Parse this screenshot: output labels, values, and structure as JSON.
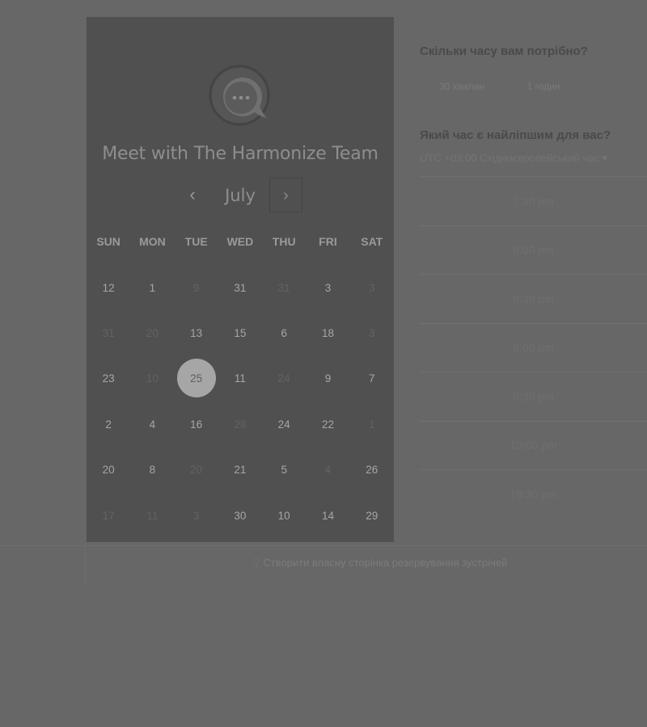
{
  "calendar": {
    "title": "Meet with The Harmonize Team",
    "month": "July",
    "prev_icon": "chevron-left-icon",
    "next_icon": "chevron-right-icon",
    "prev_glyph": "‹",
    "next_glyph": "›",
    "weekdays": [
      "SUN",
      "MON",
      "TUE",
      "WED",
      "THU",
      "FRI",
      "SAT"
    ],
    "weeks": [
      [
        {
          "d": "12",
          "muted": false
        },
        {
          "d": "1",
          "muted": false
        },
        {
          "d": "9",
          "muted": true
        },
        {
          "d": "31",
          "muted": false
        },
        {
          "d": "31",
          "muted": true
        },
        {
          "d": "3",
          "muted": false
        },
        {
          "d": "3",
          "muted": true
        }
      ],
      [
        {
          "d": "31",
          "muted": true
        },
        {
          "d": "20",
          "muted": true
        },
        {
          "d": "13",
          "muted": false
        },
        {
          "d": "15",
          "muted": false
        },
        {
          "d": "6",
          "muted": false
        },
        {
          "d": "18",
          "muted": false
        },
        {
          "d": "3",
          "muted": true
        }
      ],
      [
        {
          "d": "23",
          "muted": false
        },
        {
          "d": "10",
          "muted": true
        },
        {
          "d": "25",
          "muted": false,
          "selected": true
        },
        {
          "d": "11",
          "muted": false
        },
        {
          "d": "24",
          "muted": true
        },
        {
          "d": "9",
          "muted": false
        },
        {
          "d": "7",
          "muted": false
        }
      ],
      [
        {
          "d": "2",
          "muted": false
        },
        {
          "d": "4",
          "muted": false
        },
        {
          "d": "16",
          "muted": false
        },
        {
          "d": "28",
          "muted": true
        },
        {
          "d": "24",
          "muted": false
        },
        {
          "d": "22",
          "muted": false
        },
        {
          "d": "1",
          "muted": true
        }
      ],
      [
        {
          "d": "20",
          "muted": false
        },
        {
          "d": "8",
          "muted": false
        },
        {
          "d": "20",
          "muted": true
        },
        {
          "d": "21",
          "muted": false
        },
        {
          "d": "5",
          "muted": false
        },
        {
          "d": "4",
          "muted": true
        },
        {
          "d": "26",
          "muted": false
        }
      ],
      [
        {
          "d": "17",
          "muted": true
        },
        {
          "d": "11",
          "muted": true
        },
        {
          "d": "3",
          "muted": true
        },
        {
          "d": "30",
          "muted": false
        },
        {
          "d": "10",
          "muted": false
        },
        {
          "d": "14",
          "muted": false
        },
        {
          "d": "29",
          "muted": false
        }
      ]
    ]
  },
  "scheduler": {
    "duration_heading": "Скільки часу вам потрібно?",
    "duration_options": [
      "30 хвилин",
      "1 годин"
    ],
    "time_heading": "Який час є найліпшим для вас?",
    "timezone": "UTC +03:00 Східноєвропейський час ▾",
    "slots": [
      "7:30 pm",
      "8:00 pm",
      "8:30 pm",
      "9:00 pm",
      "9:30 pm",
      "10:00 pm",
      "10:30 pm"
    ]
  },
  "footer": {
    "create_link_text": "Створити власну сторінка резервування зустрічей"
  },
  "colors": {
    "overlay_background": "#676767",
    "calendar_panel": "#505050",
    "selected_day": "#a6a6a6"
  }
}
